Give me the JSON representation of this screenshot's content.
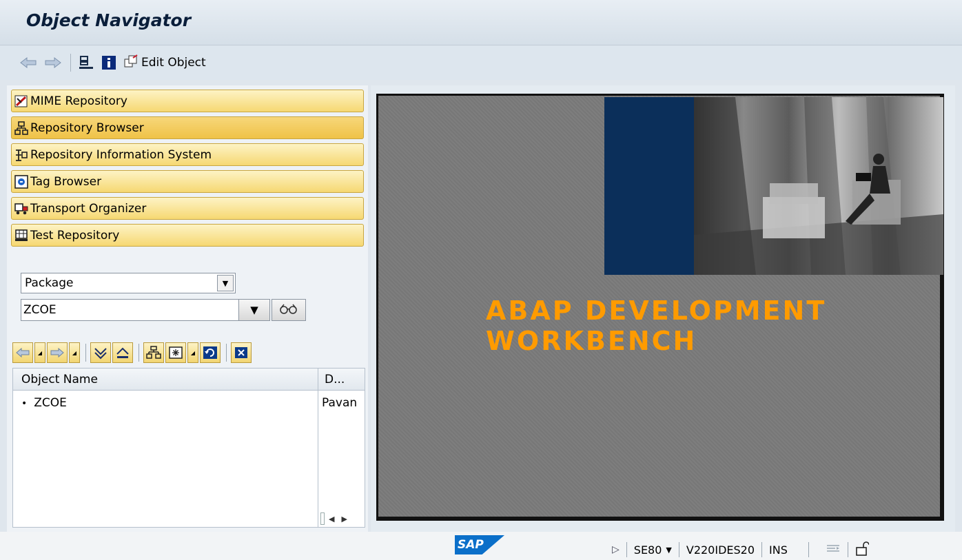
{
  "window": {
    "title": "Object Navigator"
  },
  "toolbar": {
    "edit_object_label": "Edit Object"
  },
  "nav_buttons": [
    {
      "label": "MIME Repository",
      "icon": "mime-icon"
    },
    {
      "label": "Repository Browser",
      "icon": "hierarchy-icon"
    },
    {
      "label": "Repository Information System",
      "icon": "info-system-icon"
    },
    {
      "label": "Tag Browser",
      "icon": "tag-icon"
    },
    {
      "label": "Transport Organizer",
      "icon": "truck-icon"
    },
    {
      "label": "Test Repository",
      "icon": "test-icon"
    }
  ],
  "object_type_select": {
    "value": "Package"
  },
  "object_name_field": {
    "value": "ZCOE"
  },
  "tree": {
    "columns": [
      "Object Name",
      "D..."
    ],
    "rows": [
      {
        "name": "ZCOE",
        "description": "Pavan"
      }
    ]
  },
  "splash": {
    "title_line1": "ABAP DEVELOPMENT",
    "title_line2": "WORKBENCH"
  },
  "statusbar": {
    "logo": "SAP",
    "transaction": "SE80",
    "system": "V220IDES20",
    "mode": "INS"
  },
  "colors": {
    "button_yellow": "#f6d872",
    "splash_orange": "#ff9b00",
    "splash_blue": "#0b2f5a",
    "sap_blue": "#0b6fc9"
  }
}
